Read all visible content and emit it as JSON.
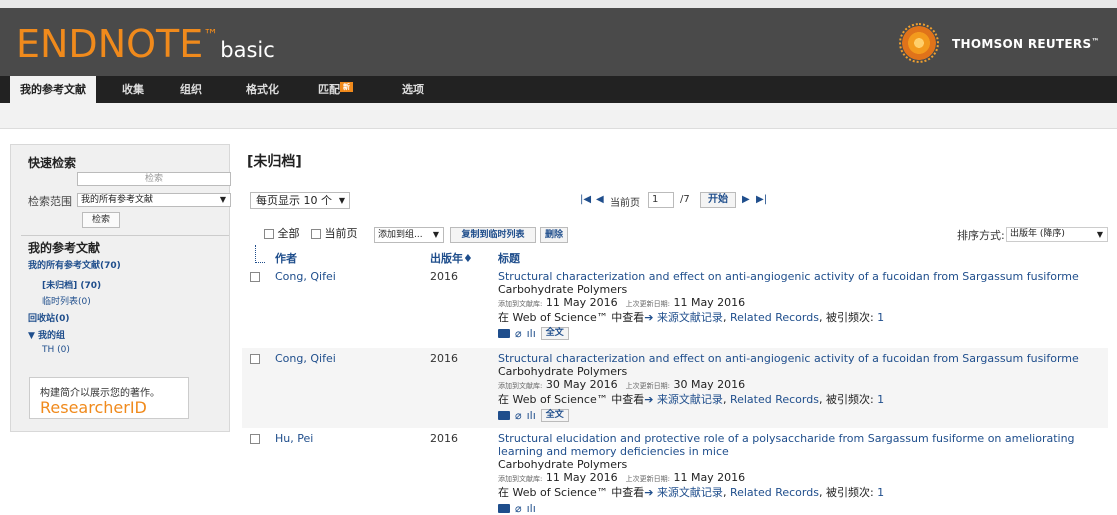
{
  "app": {
    "logo_main": "ENDNOTE",
    "logo_tm": "™",
    "logo_basic": "basic",
    "brand": "THOMSON REUTERS",
    "brand_tm": "™"
  },
  "nav": {
    "items": [
      {
        "label": "我的参考文献"
      },
      {
        "label": "收集"
      },
      {
        "label": "组织"
      },
      {
        "label": "格式化"
      },
      {
        "label": "匹配",
        "badge": "新"
      },
      {
        "label": "选项"
      }
    ]
  },
  "sidebar": {
    "quick_search_title": "快速检索",
    "search_placeholder": "检索",
    "scope_label": "检索范围",
    "scope_value": "我的所有参考文献",
    "search_button": "检索",
    "my_refs_title": "我的参考文献",
    "all_refs": "我的所有参考文献(70)",
    "unfiled": "[未归档] (70)",
    "quick_list": "临时列表(0)",
    "trash": "回收站(0)",
    "my_groups": "▼ 我的组",
    "group_th": "TH (0)",
    "rid_caption": "构建简介以展示您的著作。",
    "rid_logo": "ResearcherID"
  },
  "main": {
    "title": "[未归档]",
    "per_page": "每页显示 10 个",
    "pager": {
      "current_label": "当前页",
      "current_page": "1",
      "total": "/7",
      "go": "开始"
    },
    "toolbar": {
      "all": "全部",
      "current_page": "当前页",
      "add_to_group": "添加到组...",
      "copy_quick_list": "复制到临时列表",
      "delete": "删除"
    },
    "sort": {
      "label": "排序方式:",
      "value": "出版年 (降序)"
    },
    "columns": {
      "author": "作者",
      "year": "出版年♦",
      "title": "标题"
    },
    "records": [
      {
        "author": "Cong, Qifei",
        "year": "2016",
        "title": "Structural characterization and effect on anti-angiogenic activity of a fucoidan from Sargassum fusiforme",
        "journal": "Carbohydrate Polymers",
        "added_label": "添加到文献库:",
        "added": "11 May 2016",
        "updated_label": "上次更新日期:",
        "updated": "11 May 2016",
        "wos_prefix": "在 Web of Science™ 中查看",
        "source_link": "来源文献记录",
        "related": "Related Records",
        "cited_label": "被引频次:",
        "cited": "1",
        "fulltext": "全文"
      },
      {
        "author": "Cong, Qifei",
        "year": "2016",
        "title": "Structural characterization and effect on anti-angiogenic activity of a fucoidan from Sargassum fusiforme",
        "journal": "Carbohydrate Polymers",
        "added_label": "添加到文献库:",
        "added": "30 May 2016",
        "updated_label": "上次更新日期:",
        "updated": "30 May 2016",
        "wos_prefix": "在 Web of Science™ 中查看",
        "source_link": "来源文献记录",
        "related": "Related Records",
        "cited_label": "被引频次:",
        "cited": "1",
        "fulltext": "全文"
      },
      {
        "author": "Hu, Pei",
        "year": "2016",
        "title": "Structural elucidation and protective role of a polysaccharide from Sargassum fusiforme on ameliorating learning and memory deficiencies in mice",
        "journal": "Carbohydrate Polymers",
        "added_label": "添加到文献库:",
        "added": "11 May 2016",
        "updated_label": "上次更新日期:",
        "updated": "11 May 2016",
        "wos_prefix": "在 Web of Science™ 中查看",
        "source_link": "来源文献记录",
        "related": "Related Records",
        "cited_label": "被引频次:",
        "cited": "1"
      }
    ]
  },
  "colors": {
    "accent_orange": "#f08a1c",
    "link_blue": "#1f4e8c",
    "header_bg": "#4a4a4a",
    "nav_bg": "#222222"
  }
}
